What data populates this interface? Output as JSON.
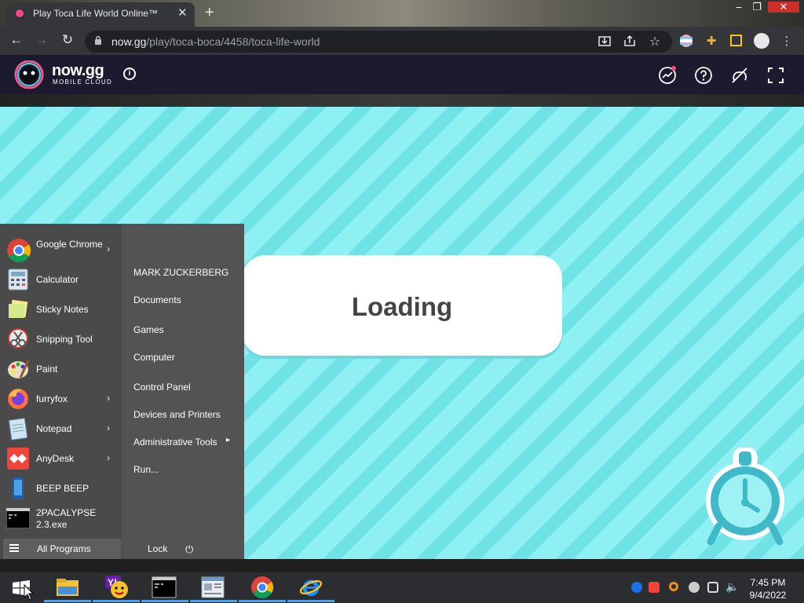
{
  "browser": {
    "tab_title": "Play Toca Life World Online™",
    "tab_close": "✕",
    "new_tab": "+",
    "url_host": "now.gg",
    "url_path": "/play/toca-boca/4458/toca-life-world",
    "nav": {
      "back": "←",
      "forward": "→",
      "reload": "↻"
    },
    "icons": [
      "download-icon",
      "share-icon",
      "star-icon",
      "profile-flag-icon",
      "extensions-icon",
      "sidebar-icon",
      "account-icon",
      "menu-icon"
    ],
    "window_controls": {
      "minimize": "–",
      "maximize": "❐",
      "close": "✕"
    }
  },
  "nowgg": {
    "logo_text": "now.gg",
    "logo_subtitle": "MOBILE CLOUD",
    "info": "i",
    "header_icons": [
      "trending-icon",
      "help-icon",
      "no-touch-icon",
      "fullscreen-icon"
    ]
  },
  "game": {
    "loading_text": "Loading",
    "accent": "#8ef0f2",
    "clock_color": "#3fb9c7"
  },
  "start_menu": {
    "pinned": [
      {
        "label": "Google Chrome",
        "has_arrow": true,
        "icon": "chrome-icon"
      },
      {
        "label": "Calculator",
        "has_arrow": false,
        "icon": "calculator-icon"
      },
      {
        "label": "Sticky Notes",
        "has_arrow": false,
        "icon": "sticky-notes-icon"
      },
      {
        "label": "Snipping Tool",
        "has_arrow": false,
        "icon": "snipping-tool-icon"
      },
      {
        "label": "Paint",
        "has_arrow": false,
        "icon": "paint-icon"
      },
      {
        "label": "furryfox",
        "has_arrow": true,
        "icon": "firefox-icon"
      },
      {
        "label": "Notepad",
        "has_arrow": true,
        "icon": "notepad-icon"
      },
      {
        "label": "AnyDesk",
        "has_arrow": true,
        "icon": "anydesk-icon"
      },
      {
        "label": "BEEP BEEP",
        "has_arrow": false,
        "icon": "phone-icon"
      },
      {
        "label": "2PACALYPSE 2.3.exe",
        "has_arrow": false,
        "icon": "console-icon"
      }
    ],
    "places": [
      {
        "label": "MARK ZUCKERBERG",
        "has_arrow": false
      },
      {
        "label": "Documents",
        "has_arrow": false
      },
      {
        "label": "Games",
        "has_arrow": false
      },
      {
        "label": "Computer",
        "has_arrow": false
      },
      {
        "label": "Control Panel",
        "has_arrow": false
      },
      {
        "label": "Devices and Printers",
        "has_arrow": false
      },
      {
        "label": "Administrative Tools",
        "has_arrow": true
      },
      {
        "label": "Run...",
        "has_arrow": false
      }
    ],
    "all_programs": "All Programs",
    "lock": "Lock",
    "power": "⏻"
  },
  "taskbar": {
    "apps": [
      "file-explorer-icon",
      "yahoo-messenger-icon",
      "command-prompt-icon",
      "notepad-window-icon",
      "chrome-icon",
      "internet-explorer-icon"
    ],
    "tray": [
      "teamviewer-icon",
      "anydesk-tray-icon",
      "search-tray-icon",
      "shield-tray-icon",
      "network-icon",
      "volume-icon"
    ],
    "time": "7:45 PM",
    "date": "9/4/2022"
  }
}
